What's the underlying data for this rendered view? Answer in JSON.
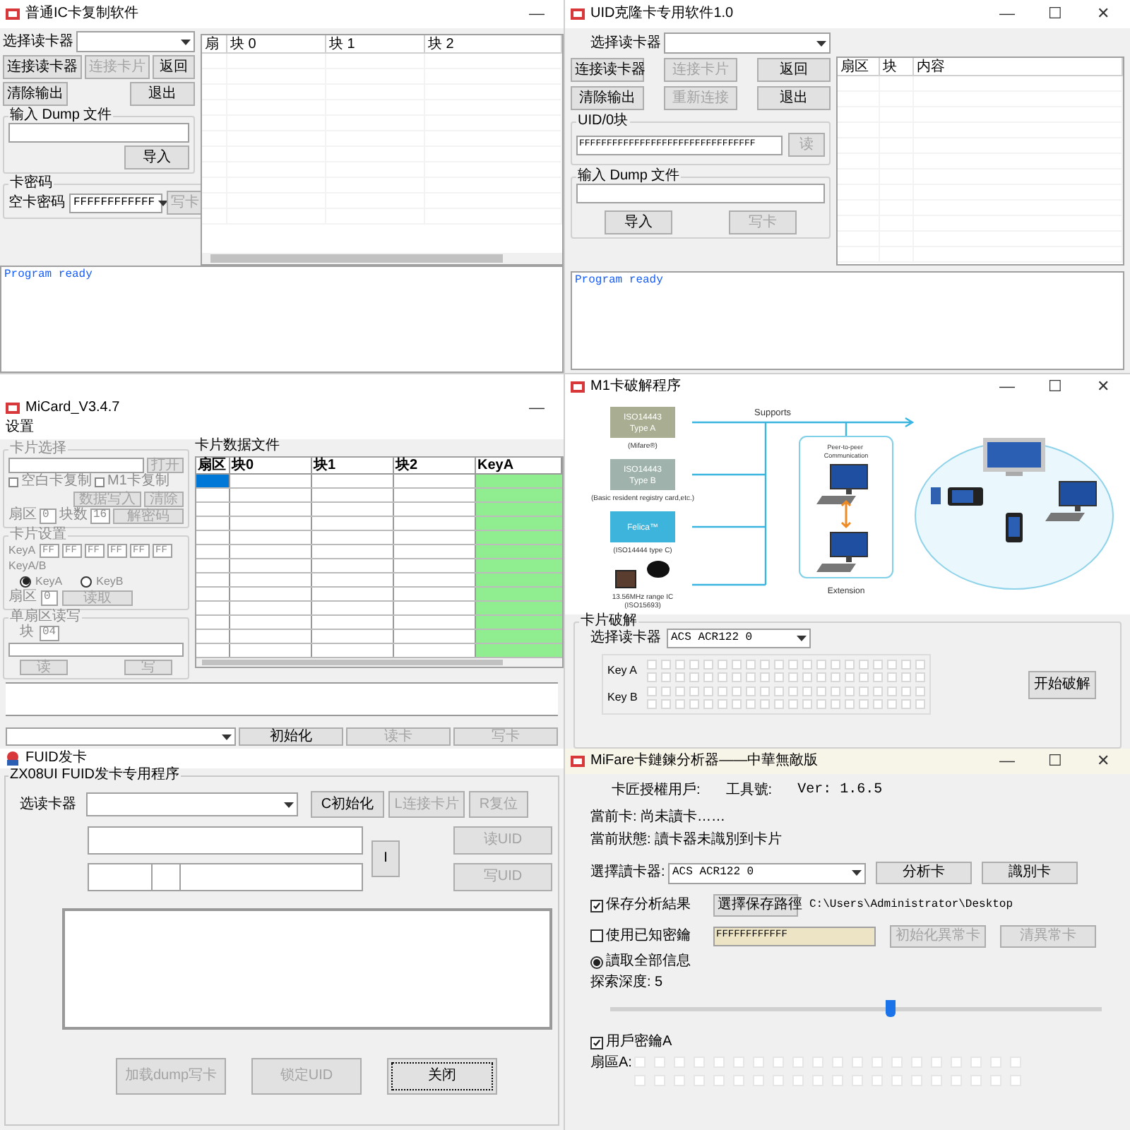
{
  "copier_window": {
    "title": "普通IC卡复制软件",
    "controls": [
      "—"
    ],
    "reader_label": "选择读卡器",
    "buttons": [
      {
        "label": "连接读卡器",
        "disabled": false
      },
      {
        "label": "连接卡片",
        "disabled": true
      },
      {
        "label": "返回",
        "disabled": false
      },
      {
        "label": "清除输出",
        "disabled": false
      },
      {
        "label": "退出",
        "disabled": false
      }
    ],
    "dump_group": {
      "title": "输入 Dump 文件",
      "button": {
        "label": "导入",
        "disabled": false
      }
    },
    "key_group": {
      "title": "卡密码",
      "key_label": "空卡密码",
      "key_value": "FFFFFFFFFFFF",
      "button": {
        "label": "写卡",
        "disabled": true
      }
    },
    "table_columns": [
      "扇",
      "块 0",
      "块 1",
      "块 2"
    ],
    "log": "Program ready"
  },
  "uid_window": {
    "title": "UID克隆卡专用软件1.0",
    "controls": [
      "—",
      "☐",
      "✕"
    ],
    "reader_label": "选择读卡器",
    "buttons": [
      {
        "label": "连接读卡器",
        "disabled": false
      },
      {
        "label": "连接卡片",
        "disabled": true
      },
      {
        "label": "返回",
        "disabled": false
      },
      {
        "label": "清除输出",
        "disabled": false
      },
      {
        "label": "重新连接",
        "disabled": true
      },
      {
        "label": "退出",
        "disabled": false
      }
    ],
    "uid_group": {
      "title": "UID/0块",
      "value": "FFFFFFFFFFFFFFFFFFFFFFFFFFFFFFFF",
      "button": {
        "label": "读",
        "disabled": true
      }
    },
    "dump_group": {
      "title": "输入 Dump 文件",
      "buttons": [
        {
          "label": "导入",
          "disabled": false
        },
        {
          "label": "写卡",
          "disabled": true
        }
      ]
    },
    "table_columns": [
      "扇区",
      "块",
      "内容"
    ],
    "log": "Program ready"
  },
  "mikard_window": {
    "title": "MiCard_V3.4.7",
    "controls": [
      "—"
    ],
    "menu": [
      "设置"
    ],
    "card_group": {
      "title": "卡片选择",
      "button": {
        "label": "打开",
        "disabled": true
      },
      "checks": [
        {
          "label": "空白卡复制",
          "checked": false
        },
        {
          "label": "M1卡复制",
          "checked": false
        }
      ],
      "buttons": [
        {
          "label": "数据写入",
          "disabled": true
        },
        {
          "label": "清除",
          "disabled": true
        }
      ],
      "sector_label": "扇区",
      "sector_value": "0",
      "block_label": "块数",
      "block_value": "16",
      "action": {
        "label": "解密码",
        "disabled": true
      }
    },
    "key_group": {
      "title": "卡片设置",
      "key_label": "KeyA",
      "key_bytes": [
        "FF",
        "FF",
        "FF",
        "FF",
        "FF",
        "FF"
      ],
      "mode_label": "KeyA/B",
      "modes": [
        {
          "label": "KeyA",
          "selected": true
        },
        {
          "label": "KeyB",
          "selected": false
        }
      ],
      "sector_label": "扇区",
      "sector_value": "0",
      "button": {
        "label": "读取",
        "disabled": true
      }
    },
    "rw_group": {
      "title": "单扇区读写",
      "block_label": "块",
      "block_value": "04",
      "buttons": [
        {
          "label": "读",
          "disabled": true
        },
        {
          "label": "写",
          "disabled": true
        }
      ]
    },
    "table": {
      "title": "卡片数据文件",
      "columns": [
        "扇区",
        "块0",
        "块1",
        "块2",
        "KeyA"
      ],
      "rows": [
        {
          "selected": true
        },
        {
          "selected": false
        },
        {
          "selected": false
        },
        {
          "selected": false
        },
        {
          "selected": false
        },
        {
          "selected": false
        },
        {
          "selected": false
        },
        {
          "selected": false
        },
        {
          "selected": false
        },
        {
          "selected": false
        },
        {
          "selected": false
        },
        {
          "selected": false
        },
        {
          "selected": false
        }
      ]
    },
    "bottom_buttons": [
      {
        "label": "初始化",
        "disabled": false
      },
      {
        "label": "读卡",
        "disabled": true
      },
      {
        "label": "写卡",
        "disabled": true
      }
    ]
  },
  "crack_window": {
    "title": "M1卡破解程序",
    "controls": [
      "—",
      "☐",
      "✕"
    ],
    "diagram": {
      "supports": "Supports",
      "items": [
        {
          "kind": "badge",
          "name": "ISO14443",
          "sub": "Type A",
          "caption": "(Mifare®)",
          "color": "#a9ad91"
        },
        {
          "kind": "badge",
          "name": "ISO14443",
          "sub": "Type B",
          "caption": "(Basic resident registry card,etc.)",
          "color": "#9fb3ac"
        },
        {
          "kind": "badge",
          "name": "Felica™",
          "caption": "(ISO14444 type C)",
          "color": "#3cb4dc"
        },
        {
          "kind": "chips",
          "captions": [
            "13.56MHz range IC",
            "(ISO15693)"
          ]
        }
      ],
      "peer": "Peer-to-peer Communication",
      "extension": "Extension"
    },
    "group": {
      "title": "卡片破解",
      "reader_label": "选择读卡器",
      "reader_value": "ACS ACR122 0",
      "key_rows": [
        {
          "label": "Key A",
          "rows": [
            [
              false,
              false,
              false,
              false,
              false,
              false,
              false,
              false,
              false,
              false,
              false,
              false,
              false,
              false,
              false,
              false,
              false,
              false,
              false,
              false
            ],
            [
              false,
              false,
              false,
              false,
              false,
              false,
              false,
              false,
              false,
              false,
              false,
              false,
              false,
              false,
              false,
              false,
              false,
              false,
              false,
              false
            ]
          ]
        },
        {
          "label": "Key B",
          "rows": [
            [
              false,
              false,
              false,
              false,
              false,
              false,
              false,
              false,
              false,
              false,
              false,
              false,
              false,
              false,
              false,
              false,
              false,
              false,
              false,
              false
            ],
            [
              false,
              false,
              false,
              false,
              false,
              false,
              false,
              false,
              false,
              false,
              false,
              false,
              false,
              false,
              false,
              false,
              false,
              false,
              false,
              false
            ]
          ]
        }
      ],
      "button": {
        "label": "开始破解",
        "disabled": false
      }
    }
  },
  "fuid_window": {
    "title": "FUID发卡",
    "group_title": "ZX08UI FUID发卡专用程序",
    "reader_label": "选读卡器",
    "top_buttons": [
      {
        "label": "C初始化",
        "disabled": false
      },
      {
        "label": "L连接卡片",
        "disabled": true
      },
      {
        "label": "R复位",
        "disabled": true
      }
    ],
    "side_button": {
      "label": "I",
      "disabled": false
    },
    "uid_buttons": [
      {
        "label": "读UID",
        "disabled": true
      },
      {
        "label": "写UID",
        "disabled": true
      }
    ],
    "bottom_buttons": [
      {
        "label": "加载dump写卡",
        "disabled": true,
        "focused": false
      },
      {
        "label": "锁定UID",
        "disabled": true,
        "focused": false
      },
      {
        "label": "关闭",
        "disabled": false,
        "focused": true
      }
    ]
  },
  "analyzer_window": {
    "title": "MiFare卡鏈鍊分析器——中華無敵版",
    "controls": [
      "—",
      "☐",
      "✕"
    ],
    "info": [
      "卡匠授權用戶:",
      "工具號:",
      "Ver: 1.6.5"
    ],
    "current_card": "當前卡: 尚未讀卡……",
    "current_status": "當前狀態: 讀卡器未識別到卡片",
    "reader_label": "選擇讀卡器:",
    "reader_value": "ACS ACR122 0",
    "reader_buttons": [
      {
        "label": "分析卡",
        "disabled": false
      },
      {
        "label": "識別卡",
        "disabled": false
      }
    ],
    "save": {
      "label": "保存分析結果",
      "checked": true,
      "button": {
        "label": "選擇保存路徑",
        "disabled": false
      },
      "path": "C:\\Users\\Administrator\\Desktop"
    },
    "known_key": {
      "label": "使用已知密鑰",
      "checked": false,
      "value": "FFFFFFFFFFFF",
      "buttons": [
        {
          "label": "初始化異常卡",
          "disabled": true
        },
        {
          "label": "清異常卡",
          "disabled": true
        }
      ]
    },
    "read_all": {
      "label": "讀取全部信息",
      "selected": true
    },
    "depth_label": "探索深度: 5",
    "depth": {
      "level": 0.57
    },
    "user_key": {
      "label": "用戶密鑰A",
      "checked": true
    },
    "sector_label": "扇區A:",
    "sector_rows": [
      [
        false,
        false,
        false,
        false,
        false,
        false,
        false,
        false,
        false,
        false,
        false,
        false,
        false,
        false,
        false,
        false,
        false,
        false,
        false,
        false
      ],
      [
        false,
        false,
        false,
        false,
        false,
        false,
        false,
        false,
        false,
        false,
        false,
        false,
        false,
        false,
        false,
        false,
        false,
        false,
        false,
        false
      ]
    ]
  }
}
